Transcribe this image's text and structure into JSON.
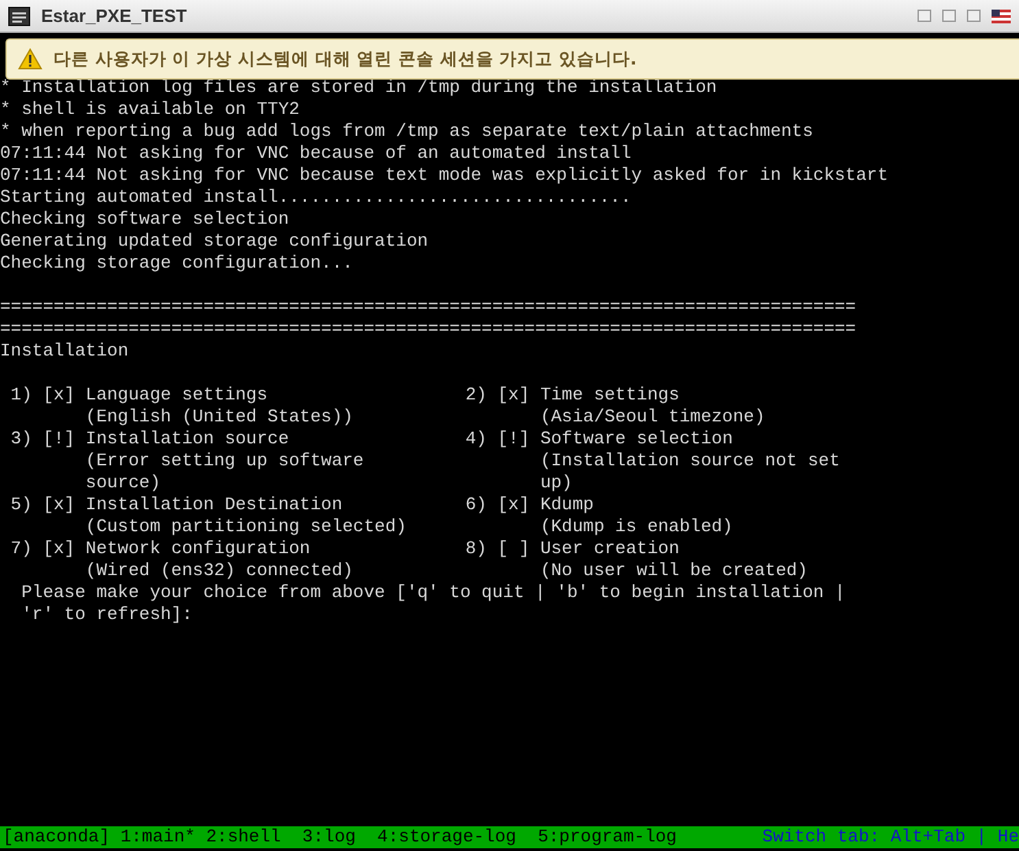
{
  "window": {
    "title": "Estar_PXE_TEST"
  },
  "notice": {
    "text": "다른 사용자가 이 가상 시스템에 대해 열린 콘솔 세션을 가지고 있습니다."
  },
  "console": {
    "log_lines": [
      "* Installation log files are stored in /tmp during the installation",
      "* shell is available on TTY2",
      "* when reporting a bug add logs from /tmp as separate text/plain attachments",
      "07:11:44 Not asking for VNC because of an automated install",
      "07:11:44 Not asking for VNC because text mode was explicitly asked for in kickstart",
      "Starting automated install.................................",
      "Checking software selection",
      "Generating updated storage configuration",
      "Checking storage configuration..."
    ],
    "separators": [
      "================================================================================",
      "================================================================================"
    ],
    "heading": "Installation",
    "menu": [
      {
        "number": "1)",
        "status": "[x]",
        "title": "Language settings",
        "detail": [
          "(English (United States))"
        ]
      },
      {
        "number": "2)",
        "status": "[x]",
        "title": "Time settings",
        "detail": [
          "(Asia/Seoul timezone)"
        ]
      },
      {
        "number": "3)",
        "status": "[!]",
        "title": "Installation source",
        "detail": [
          "(Error setting up software",
          "source)"
        ]
      },
      {
        "number": "4)",
        "status": "[!]",
        "title": "Software selection",
        "detail": [
          "(Installation source not set",
          "up)"
        ]
      },
      {
        "number": "5)",
        "status": "[x]",
        "title": "Installation Destination",
        "detail": [
          "(Custom partitioning selected)"
        ]
      },
      {
        "number": "6)",
        "status": "[x]",
        "title": "Kdump",
        "detail": [
          "(Kdump is enabled)"
        ]
      },
      {
        "number": "7)",
        "status": "[x]",
        "title": "Network configuration",
        "detail": [
          "(Wired (ens32) connected)"
        ]
      },
      {
        "number": "8)",
        "status": "[ ]",
        "title": "User creation",
        "detail": [
          "(No user will be created)"
        ]
      }
    ],
    "prompt": [
      "Please make your choice from above ['q' to quit | 'b' to begin installation |",
      "'r' to refresh]:"
    ]
  },
  "status_bar": {
    "tabs": "[anaconda] 1:main* 2:shell  3:log  4:storage-log  5:program-log",
    "hint": "Switch tab: Alt+Tab | He"
  }
}
